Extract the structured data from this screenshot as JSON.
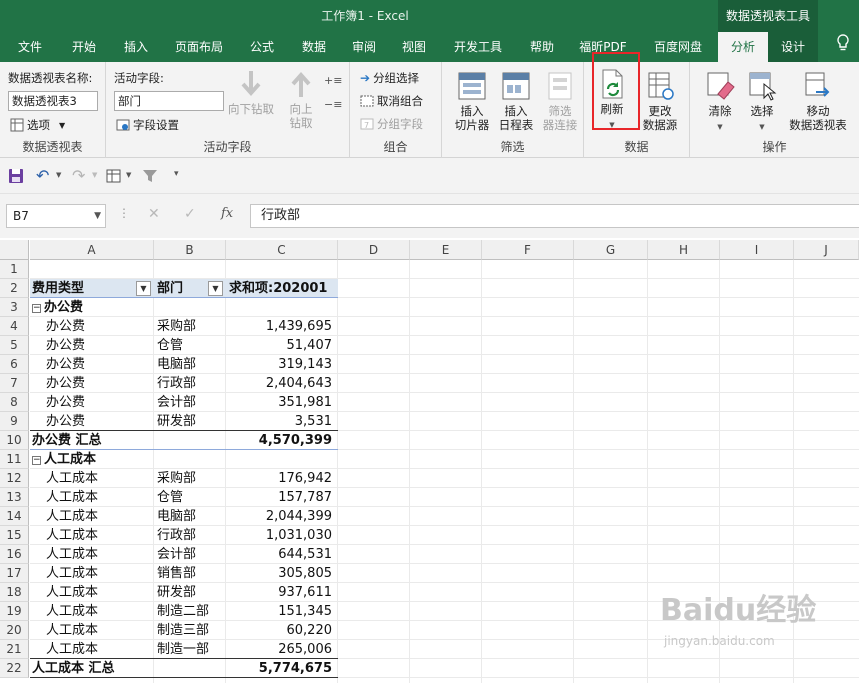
{
  "window": {
    "title": "工作簿1  -  Excel",
    "context_tools": "数据透视表工具"
  },
  "tabs": [
    "文件",
    "开始",
    "插入",
    "页面布局",
    "公式",
    "数据",
    "审阅",
    "视图",
    "开发工具",
    "帮助",
    "福昕PDF",
    "百度网盘",
    "分析",
    "设计"
  ],
  "ribbon": {
    "pivot_table": {
      "name_label": "数据透视表名称:",
      "name_value": "数据透视表3",
      "options_label": "选项",
      "group_label": "数据透视表"
    },
    "active_field": {
      "label": "活动字段:",
      "value": "部门",
      "field_settings": "字段设置",
      "drill_down": "向下钻取",
      "drill_up": "向上钻取",
      "group_label": "活动字段"
    },
    "group": {
      "group_selection": "分组选择",
      "ungroup": "取消组合",
      "group_field": "分组字段",
      "group_label": "组合"
    },
    "filter": {
      "insert_slicer": "插入\n切片器",
      "insert_timeline": "插入\n日程表",
      "filter_connections": "筛选\n器连接",
      "group_label": "筛选"
    },
    "data": {
      "refresh": "刷新",
      "change_source": "更改\n数据源",
      "group_label": "数据"
    },
    "actions": {
      "clear": "清除",
      "select": "选择",
      "move": "移动\n数据透视表",
      "group_label": "操作"
    }
  },
  "formula_bar": {
    "name_box": "B7",
    "content": "行政部"
  },
  "columns": [
    "A",
    "B",
    "C",
    "D",
    "E",
    "F",
    "G",
    "H",
    "I",
    "J"
  ],
  "rows": [
    "1",
    "2",
    "3",
    "4",
    "5",
    "6",
    "7",
    "8",
    "9",
    "10",
    "11",
    "12",
    "13",
    "14",
    "15",
    "16",
    "17",
    "18",
    "19",
    "20",
    "21",
    "22"
  ],
  "pivot": {
    "headers": [
      "费用类型",
      "部门",
      "求和项:202001"
    ],
    "rows": [
      {
        "r": 3,
        "a": "办公费",
        "b": "",
        "c": "",
        "type": "group"
      },
      {
        "r": 4,
        "a": "办公费",
        "b": "采购部",
        "c": "1,439,695",
        "type": "item"
      },
      {
        "r": 5,
        "a": "办公费",
        "b": "仓管",
        "c": "51,407",
        "type": "item"
      },
      {
        "r": 6,
        "a": "办公费",
        "b": "电脑部",
        "c": "319,143",
        "type": "item"
      },
      {
        "r": 7,
        "a": "办公费",
        "b": "行政部",
        "c": "2,404,643",
        "type": "item"
      },
      {
        "r": 8,
        "a": "办公费",
        "b": "会计部",
        "c": "351,981",
        "type": "item"
      },
      {
        "r": 9,
        "a": "办公费",
        "b": "研发部",
        "c": "3,531",
        "type": "item"
      },
      {
        "r": 10,
        "a": "办公费 汇总",
        "b": "",
        "c": "4,570,399",
        "type": "total"
      },
      {
        "r": 11,
        "a": "人工成本",
        "b": "",
        "c": "",
        "type": "group"
      },
      {
        "r": 12,
        "a": "人工成本",
        "b": "采购部",
        "c": "176,942",
        "type": "item"
      },
      {
        "r": 13,
        "a": "人工成本",
        "b": "仓管",
        "c": "157,787",
        "type": "item"
      },
      {
        "r": 14,
        "a": "人工成本",
        "b": "电脑部",
        "c": "2,044,399",
        "type": "item"
      },
      {
        "r": 15,
        "a": "人工成本",
        "b": "行政部",
        "c": "1,031,030",
        "type": "item"
      },
      {
        "r": 16,
        "a": "人工成本",
        "b": "会计部",
        "c": "644,531",
        "type": "item"
      },
      {
        "r": 17,
        "a": "人工成本",
        "b": "销售部",
        "c": "305,805",
        "type": "item"
      },
      {
        "r": 18,
        "a": "人工成本",
        "b": "研发部",
        "c": "937,611",
        "type": "item"
      },
      {
        "r": 19,
        "a": "人工成本",
        "b": "制造二部",
        "c": "151,345",
        "type": "item"
      },
      {
        "r": 20,
        "a": "人工成本",
        "b": "制造三部",
        "c": "60,220",
        "type": "item"
      },
      {
        "r": 21,
        "a": "人工成本",
        "b": "制造一部",
        "c": "265,006",
        "type": "item"
      },
      {
        "r": 22,
        "a": "人工成本 汇总",
        "b": "",
        "c": "5,774,675",
        "type": "total"
      }
    ]
  },
  "watermark": {
    "logo": "Baidu经验",
    "url": "jingyan.baidu.com"
  },
  "colors": {
    "excel_green": "#217346",
    "pivot_header": "#dce6f1",
    "highlight": "#e8262a"
  }
}
